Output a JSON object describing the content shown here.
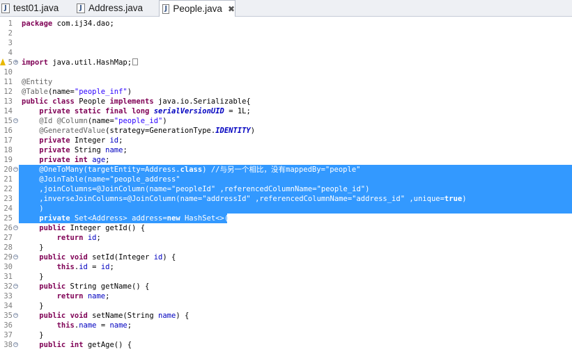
{
  "tabs": [
    {
      "label": "test01.java",
      "icon": "java-file-icon"
    },
    {
      "label": "Address.java",
      "icon": "java-file-icon"
    },
    {
      "label": "People.java",
      "icon": "java-file-icon",
      "active": true,
      "close": "✖"
    }
  ],
  "file_icon_glyph": "J",
  "lines": [
    {
      "n": "1",
      "text": "package com.ij34.dao;"
    },
    {
      "n": "2",
      "text": ""
    },
    {
      "n": "3",
      "text": ""
    },
    {
      "n": "4",
      "text": ""
    },
    {
      "n": "5",
      "text": "import java.util.HashMap;"
    },
    {
      "n": "10",
      "text": ""
    },
    {
      "n": "11",
      "text": "@Entity"
    },
    {
      "n": "12",
      "text": "@Table(name=\"people_inf\")"
    },
    {
      "n": "13",
      "text": "public class People implements java.io.Serializable{"
    },
    {
      "n": "14",
      "text": "    private static final long serialVersionUID = 1L;"
    },
    {
      "n": "15",
      "text": "    @Id @Column(name=\"people_id\")"
    },
    {
      "n": "16",
      "text": "    @GeneratedValue(strategy=GenerationType.IDENTITY)"
    },
    {
      "n": "17",
      "text": "    private Integer id;"
    },
    {
      "n": "18",
      "text": "    private String name;"
    },
    {
      "n": "19",
      "text": "    private int age;"
    },
    {
      "n": "20",
      "text": "    @OneToMany(targetEntity=Address.class) //与另一个相比，没有mappedBy=\"people\""
    },
    {
      "n": "21",
      "text": "    @JoinTable(name=\"people_address\""
    },
    {
      "n": "22",
      "text": "    ,joinColumns=@JoinColumn(name=\"peopleId\" ,referencedColumnName=\"people_id\")"
    },
    {
      "n": "23",
      "text": "    ,inverseJoinColumns=@JoinColumn(name=\"addressId\" ,referencedColumnName=\"address_id\" ,unique=true)"
    },
    {
      "n": "24",
      "text": "    )"
    },
    {
      "n": "25",
      "text": "    private Set<Address> address=new HashSet<>();"
    },
    {
      "n": "26",
      "text": "    public Integer getId() {"
    },
    {
      "n": "27",
      "text": "        return id;"
    },
    {
      "n": "28",
      "text": "    }"
    },
    {
      "n": "29",
      "text": "    public void setId(Integer id) {"
    },
    {
      "n": "30",
      "text": "        this.id = id;"
    },
    {
      "n": "31",
      "text": "    }"
    },
    {
      "n": "32",
      "text": "    public String getName() {"
    },
    {
      "n": "33",
      "text": "        return name;"
    },
    {
      "n": "34",
      "text": "    }"
    },
    {
      "n": "35",
      "text": "    public void setName(String name) {"
    },
    {
      "n": "36",
      "text": "        this.name = name;"
    },
    {
      "n": "37",
      "text": "    }"
    },
    {
      "n": "38",
      "text": "    public int getAge() {"
    }
  ],
  "colors": {
    "keyword": "#7f0055",
    "string": "#2a00ff",
    "annotation": "#646464",
    "field": "#0000c0",
    "selection": "#3399ff"
  }
}
